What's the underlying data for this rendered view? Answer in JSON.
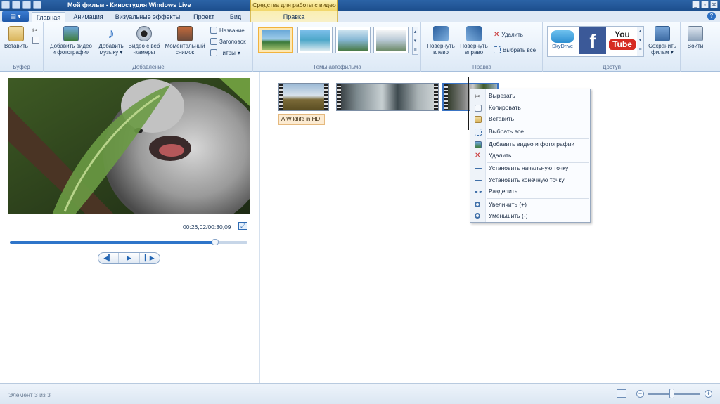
{
  "window": {
    "title": "Мой фильм - Киностудия Windows Live",
    "context_group_label": "Средства для работы с видео",
    "controls": [
      "_",
      "▫",
      "✕"
    ]
  },
  "tabs": [
    {
      "label": "Главная",
      "active": true
    },
    {
      "label": "Анимация",
      "active": false
    },
    {
      "label": "Визуальные эффекты",
      "active": false
    },
    {
      "label": "Проект",
      "active": false
    },
    {
      "label": "Вид",
      "active": false
    },
    {
      "label": "Правка",
      "active": false
    }
  ],
  "app_menu_icon": "app-menu-icon",
  "ribbon": {
    "clipboard": {
      "group": "Буфер",
      "paste": "Вставить"
    },
    "add": {
      "group": "Добавление",
      "add_video_line1": "Добавить видео",
      "add_video_line2": "и фотографии",
      "add_music_line1": "Добавить",
      "add_music_line2": "музыку",
      "webcam_line1": "Видео с веб",
      "webcam_line2": "-камеры",
      "snapshot_line1": "Моментальный",
      "snapshot_line2": "снимок",
      "title": "Название",
      "caption": "Заголовок",
      "credits": "Титры"
    },
    "themes": {
      "group": "Темы автофильма"
    },
    "edit": {
      "group": "Правка",
      "rotate_left_line1": "Повернуть",
      "rotate_left_line2": "влево",
      "rotate_right_line1": "Повернуть",
      "rotate_right_line2": "вправо",
      "delete": "Удалить",
      "select_all": "Выбрать все"
    },
    "share": {
      "group": "Доступ",
      "skydrive": "SkyDrive",
      "facebook": "f",
      "youtube_1": "You",
      "youtube_2": "Tube",
      "save_movie_line1": "Сохранить",
      "save_movie_line2": "фильм"
    },
    "signin": {
      "label": "Войти"
    }
  },
  "preview": {
    "timecode": "00:26,02/00:30,09",
    "progress_fraction": 0.865,
    "buttons": [
      "◀▎",
      "▶",
      "▎▶"
    ]
  },
  "storyboard": {
    "title_clip": "A Wildlife in HD"
  },
  "context_menu": [
    {
      "label": "Вырезать",
      "icon": "scissors-icon"
    },
    {
      "label": "Копировать",
      "icon": "copy-icon"
    },
    {
      "label": "Вставить",
      "icon": "paste-icon"
    },
    {
      "label": "Выбрать все",
      "icon": "select-all-icon"
    },
    {
      "label": "Добавить видео и фотографии",
      "icon": "add-media-icon"
    },
    {
      "label": "Удалить",
      "icon": "delete-icon"
    },
    {
      "label": "Установить начальную точку",
      "icon": "start-point-icon"
    },
    {
      "label": "Установить конечную точку",
      "icon": "end-point-icon"
    },
    {
      "label": "Разделить",
      "icon": "split-icon"
    },
    {
      "label": "Увеличить (+)",
      "icon": "zoom-in-icon"
    },
    {
      "label": "Уменьшить (-)",
      "icon": "zoom-out-icon"
    }
  ],
  "status": {
    "text": "Элемент 3 из 3",
    "zoom_fraction": 0.45,
    "zoom_out": "−",
    "zoom_in": "+"
  },
  "colors": {
    "accent": "#2f75c9",
    "title_bar": "#2b63a6",
    "context_tab": "#f1d66a"
  }
}
